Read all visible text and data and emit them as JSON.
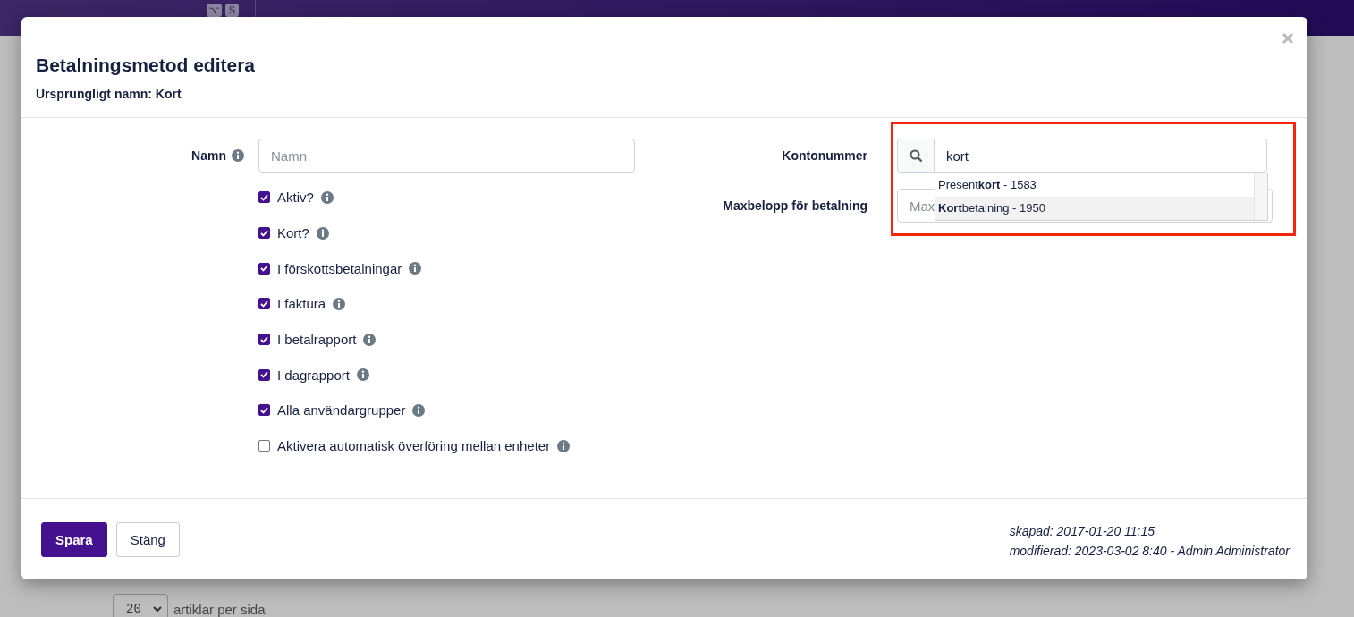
{
  "background": {
    "badges": [
      "⌥",
      "S"
    ],
    "page_size": {
      "value": "20",
      "label": "artiklar per sida"
    }
  },
  "modal": {
    "title": "Betalningsmetod editera",
    "subtitle_label": "Ursprungligt namn:",
    "subtitle_value": "Kort",
    "name_field": {
      "label": "Namn",
      "placeholder": "Namn"
    },
    "checkboxes": [
      {
        "label": "Aktiv?",
        "checked": true
      },
      {
        "label": "Kort?",
        "checked": true
      },
      {
        "label": "I förskottsbetalningar",
        "checked": true
      },
      {
        "label": "I faktura",
        "checked": true
      },
      {
        "label": "I betalrapport",
        "checked": true
      },
      {
        "label": "I dagrapport",
        "checked": true
      },
      {
        "label": "Alla användargrupper",
        "checked": true
      },
      {
        "label": "Aktivera automatisk överföring mellan enheter",
        "checked": false
      }
    ],
    "account_field": {
      "label": "Kontonummer",
      "value": "kort"
    },
    "suggestions": [
      {
        "text": "Present**kort** - 1583",
        "selected": false
      },
      {
        "text": "**Kort**betalning - 1950",
        "selected": true
      }
    ],
    "max_field": {
      "label": "Maxbelopp för betalning",
      "placeholder": "Max"
    },
    "buttons": [
      "Spara",
      "Stäng"
    ],
    "created": "skapad: 2017-01-20 11:15",
    "modified": "modifierad: 2023-03-02 8:40 - Admin Administrator"
  }
}
